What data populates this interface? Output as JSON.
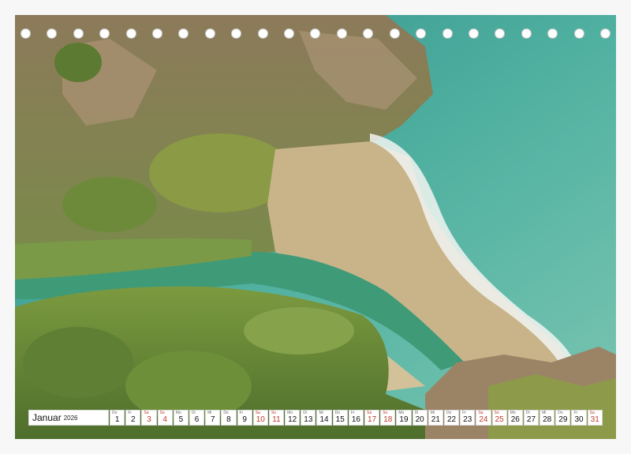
{
  "calendar": {
    "month": "Januar",
    "year": "2026",
    "days": [
      {
        "wd": "Do",
        "n": "1",
        "weekend": false
      },
      {
        "wd": "Fr",
        "n": "2",
        "weekend": false
      },
      {
        "wd": "Sa",
        "n": "3",
        "weekend": true
      },
      {
        "wd": "So",
        "n": "4",
        "weekend": true
      },
      {
        "wd": "Mo",
        "n": "5",
        "weekend": false
      },
      {
        "wd": "Di",
        "n": "6",
        "weekend": false
      },
      {
        "wd": "Mi",
        "n": "7",
        "weekend": false
      },
      {
        "wd": "Do",
        "n": "8",
        "weekend": false
      },
      {
        "wd": "Fr",
        "n": "9",
        "weekend": false
      },
      {
        "wd": "Sa",
        "n": "10",
        "weekend": true
      },
      {
        "wd": "So",
        "n": "11",
        "weekend": true
      },
      {
        "wd": "Mo",
        "n": "12",
        "weekend": false
      },
      {
        "wd": "Di",
        "n": "13",
        "weekend": false
      },
      {
        "wd": "Mi",
        "n": "14",
        "weekend": false
      },
      {
        "wd": "Do",
        "n": "15",
        "weekend": false
      },
      {
        "wd": "Fr",
        "n": "16",
        "weekend": false
      },
      {
        "wd": "Sa",
        "n": "17",
        "weekend": true
      },
      {
        "wd": "So",
        "n": "18",
        "weekend": true
      },
      {
        "wd": "Mo",
        "n": "19",
        "weekend": false
      },
      {
        "wd": "Di",
        "n": "20",
        "weekend": false
      },
      {
        "wd": "Mi",
        "n": "21",
        "weekend": false
      },
      {
        "wd": "Do",
        "n": "22",
        "weekend": false
      },
      {
        "wd": "Fr",
        "n": "23",
        "weekend": false
      },
      {
        "wd": "Sa",
        "n": "24",
        "weekend": true
      },
      {
        "wd": "So",
        "n": "25",
        "weekend": true
      },
      {
        "wd": "Mo",
        "n": "26",
        "weekend": false
      },
      {
        "wd": "Di",
        "n": "27",
        "weekend": false
      },
      {
        "wd": "Mi",
        "n": "28",
        "weekend": false
      },
      {
        "wd": "Do",
        "n": "29",
        "weekend": false
      },
      {
        "wd": "Fr",
        "n": "30",
        "weekend": false
      },
      {
        "wd": "Sa",
        "n": "31",
        "weekend": true
      }
    ]
  },
  "colors": {
    "sea": "#4fb0a0",
    "sand": "#c9b48a",
    "river": "#3f9a78",
    "vegetation": "#6f8f3f",
    "rock": "#9b8466",
    "weekend": "#c0392b"
  },
  "binding_holes": 23
}
